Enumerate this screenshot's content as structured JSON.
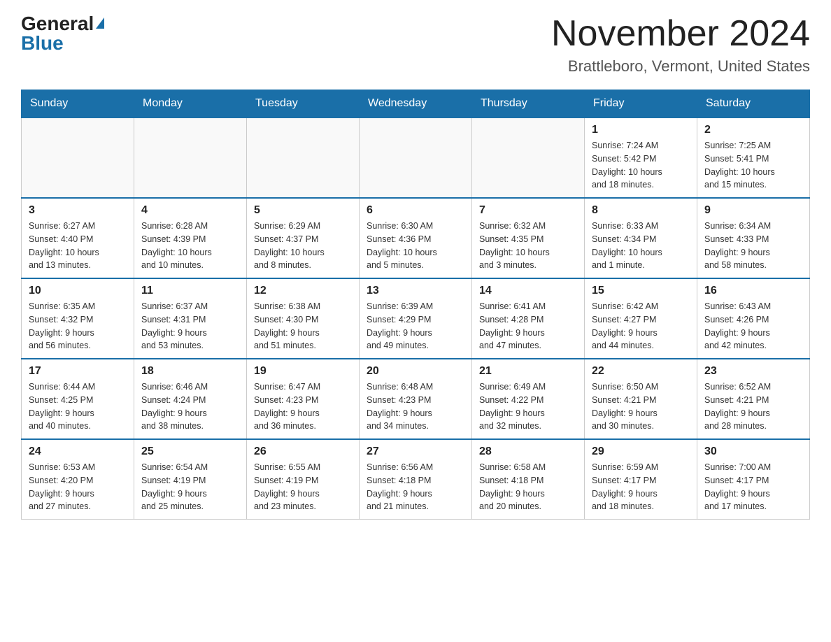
{
  "header": {
    "logo_general": "General",
    "logo_blue": "Blue",
    "month_title": "November 2024",
    "location": "Brattleboro, Vermont, United States"
  },
  "days_of_week": [
    "Sunday",
    "Monday",
    "Tuesday",
    "Wednesday",
    "Thursday",
    "Friday",
    "Saturday"
  ],
  "weeks": [
    {
      "days": [
        {
          "date": "",
          "info": ""
        },
        {
          "date": "",
          "info": ""
        },
        {
          "date": "",
          "info": ""
        },
        {
          "date": "",
          "info": ""
        },
        {
          "date": "",
          "info": ""
        },
        {
          "date": "1",
          "info": "Sunrise: 7:24 AM\nSunset: 5:42 PM\nDaylight: 10 hours\nand 18 minutes."
        },
        {
          "date": "2",
          "info": "Sunrise: 7:25 AM\nSunset: 5:41 PM\nDaylight: 10 hours\nand 15 minutes."
        }
      ]
    },
    {
      "days": [
        {
          "date": "3",
          "info": "Sunrise: 6:27 AM\nSunset: 4:40 PM\nDaylight: 10 hours\nand 13 minutes."
        },
        {
          "date": "4",
          "info": "Sunrise: 6:28 AM\nSunset: 4:39 PM\nDaylight: 10 hours\nand 10 minutes."
        },
        {
          "date": "5",
          "info": "Sunrise: 6:29 AM\nSunset: 4:37 PM\nDaylight: 10 hours\nand 8 minutes."
        },
        {
          "date": "6",
          "info": "Sunrise: 6:30 AM\nSunset: 4:36 PM\nDaylight: 10 hours\nand 5 minutes."
        },
        {
          "date": "7",
          "info": "Sunrise: 6:32 AM\nSunset: 4:35 PM\nDaylight: 10 hours\nand 3 minutes."
        },
        {
          "date": "8",
          "info": "Sunrise: 6:33 AM\nSunset: 4:34 PM\nDaylight: 10 hours\nand 1 minute."
        },
        {
          "date": "9",
          "info": "Sunrise: 6:34 AM\nSunset: 4:33 PM\nDaylight: 9 hours\nand 58 minutes."
        }
      ]
    },
    {
      "days": [
        {
          "date": "10",
          "info": "Sunrise: 6:35 AM\nSunset: 4:32 PM\nDaylight: 9 hours\nand 56 minutes."
        },
        {
          "date": "11",
          "info": "Sunrise: 6:37 AM\nSunset: 4:31 PM\nDaylight: 9 hours\nand 53 minutes."
        },
        {
          "date": "12",
          "info": "Sunrise: 6:38 AM\nSunset: 4:30 PM\nDaylight: 9 hours\nand 51 minutes."
        },
        {
          "date": "13",
          "info": "Sunrise: 6:39 AM\nSunset: 4:29 PM\nDaylight: 9 hours\nand 49 minutes."
        },
        {
          "date": "14",
          "info": "Sunrise: 6:41 AM\nSunset: 4:28 PM\nDaylight: 9 hours\nand 47 minutes."
        },
        {
          "date": "15",
          "info": "Sunrise: 6:42 AM\nSunset: 4:27 PM\nDaylight: 9 hours\nand 44 minutes."
        },
        {
          "date": "16",
          "info": "Sunrise: 6:43 AM\nSunset: 4:26 PM\nDaylight: 9 hours\nand 42 minutes."
        }
      ]
    },
    {
      "days": [
        {
          "date": "17",
          "info": "Sunrise: 6:44 AM\nSunset: 4:25 PM\nDaylight: 9 hours\nand 40 minutes."
        },
        {
          "date": "18",
          "info": "Sunrise: 6:46 AM\nSunset: 4:24 PM\nDaylight: 9 hours\nand 38 minutes."
        },
        {
          "date": "19",
          "info": "Sunrise: 6:47 AM\nSunset: 4:23 PM\nDaylight: 9 hours\nand 36 minutes."
        },
        {
          "date": "20",
          "info": "Sunrise: 6:48 AM\nSunset: 4:23 PM\nDaylight: 9 hours\nand 34 minutes."
        },
        {
          "date": "21",
          "info": "Sunrise: 6:49 AM\nSunset: 4:22 PM\nDaylight: 9 hours\nand 32 minutes."
        },
        {
          "date": "22",
          "info": "Sunrise: 6:50 AM\nSunset: 4:21 PM\nDaylight: 9 hours\nand 30 minutes."
        },
        {
          "date": "23",
          "info": "Sunrise: 6:52 AM\nSunset: 4:21 PM\nDaylight: 9 hours\nand 28 minutes."
        }
      ]
    },
    {
      "days": [
        {
          "date": "24",
          "info": "Sunrise: 6:53 AM\nSunset: 4:20 PM\nDaylight: 9 hours\nand 27 minutes."
        },
        {
          "date": "25",
          "info": "Sunrise: 6:54 AM\nSunset: 4:19 PM\nDaylight: 9 hours\nand 25 minutes."
        },
        {
          "date": "26",
          "info": "Sunrise: 6:55 AM\nSunset: 4:19 PM\nDaylight: 9 hours\nand 23 minutes."
        },
        {
          "date": "27",
          "info": "Sunrise: 6:56 AM\nSunset: 4:18 PM\nDaylight: 9 hours\nand 21 minutes."
        },
        {
          "date": "28",
          "info": "Sunrise: 6:58 AM\nSunset: 4:18 PM\nDaylight: 9 hours\nand 20 minutes."
        },
        {
          "date": "29",
          "info": "Sunrise: 6:59 AM\nSunset: 4:17 PM\nDaylight: 9 hours\nand 18 minutes."
        },
        {
          "date": "30",
          "info": "Sunrise: 7:00 AM\nSunset: 4:17 PM\nDaylight: 9 hours\nand 17 minutes."
        }
      ]
    }
  ]
}
